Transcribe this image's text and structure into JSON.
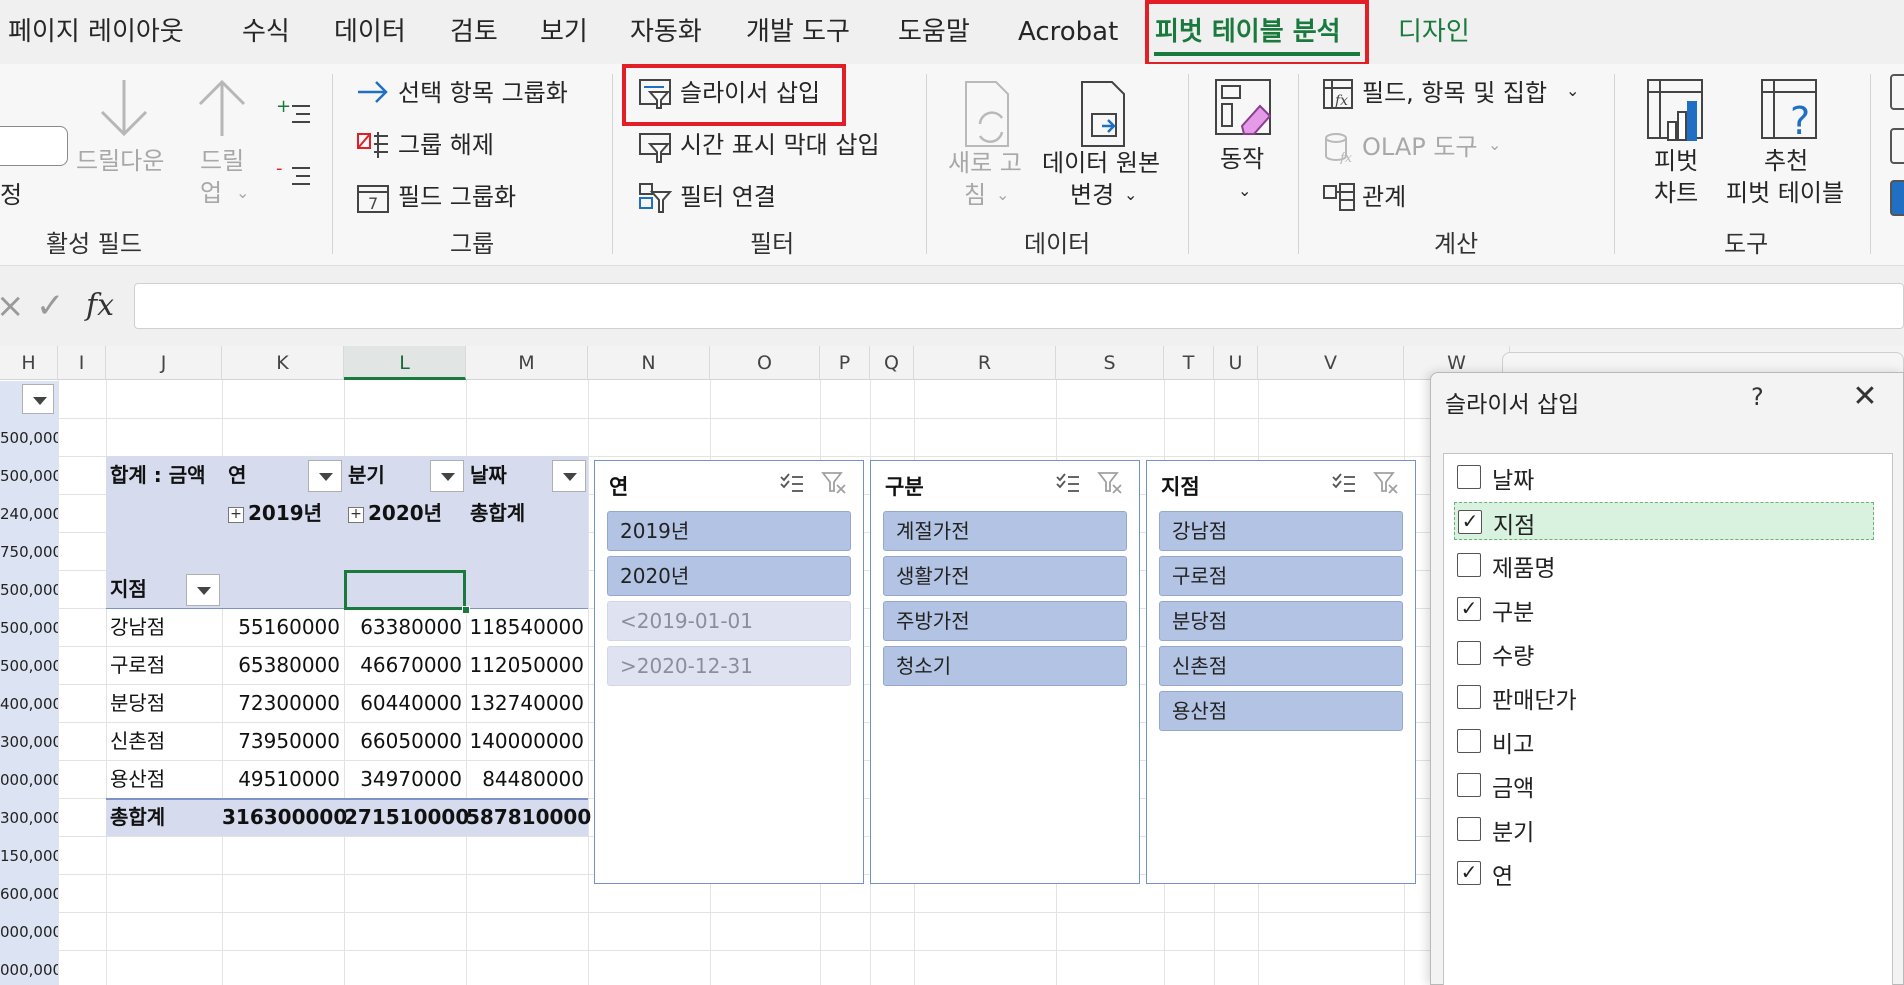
{
  "menu": {
    "tabs": [
      {
        "label": "페이지 레이아웃"
      },
      {
        "label": "수식"
      },
      {
        "label": "데이터"
      },
      {
        "label": "검토"
      },
      {
        "label": "보기"
      },
      {
        "label": "자동화"
      },
      {
        "label": "개발 도구"
      },
      {
        "label": "도움말"
      },
      {
        "label": "Acrobat"
      },
      {
        "label": "피벗 테이블 분석"
      },
      {
        "label": "디자인"
      }
    ],
    "active_tab": "피벗 테이블 분석"
  },
  "ribbon": {
    "active_field": {
      "partial_label": "정",
      "drilldown": "드릴다운",
      "drillup_1": "드릴",
      "drillup_2": "업",
      "group_label": "활성 필드"
    },
    "group": {
      "group_selection": "선택 항목 그룹화",
      "ungroup": "그룹 해제",
      "group_field": "필드 그룹화",
      "group_label": "그룹"
    },
    "filter": {
      "insert_slicer": "슬라이서 삽입",
      "insert_timeline": "시간 표시 막대 삽입",
      "filter_connections": "필터 연결",
      "group_label": "필터"
    },
    "data": {
      "refresh_1": "새로 고",
      "refresh_2": "침",
      "change_source_1": "데이터 원본",
      "change_source_2": "변경",
      "group_label": "데이터"
    },
    "actions": {
      "label": "동작"
    },
    "calculations": {
      "fields_items_sets": "필드, 항목 및 집합",
      "olap_tools": "OLAP 도구",
      "relationships": "관계",
      "group_label": "계산"
    },
    "tools": {
      "pivot_chart_1": "피벗",
      "pivot_chart_2": "차트",
      "recommended_1": "추천",
      "recommended_2": "피벗 테이블",
      "group_label": "도구"
    }
  },
  "formula_bar": {
    "cancel": "×",
    "enter": "✓",
    "fx": "fx",
    "value": ""
  },
  "sheet": {
    "columns": [
      "H",
      "I",
      "J",
      "K",
      "L",
      "M",
      "N",
      "O",
      "P",
      "Q",
      "R",
      "S",
      "T",
      "U",
      "V",
      "W"
    ],
    "selected_column": "L",
    "column_h_values": [
      "",
      "500,000",
      "500,000",
      "240,000",
      "750,000",
      "500,000",
      "500,000",
      "500,000",
      "400,000",
      "300,000",
      "000,000",
      "300,000",
      "150,000",
      "600,000",
      "000,000",
      "000,000"
    ],
    "pivot": {
      "value_label": "합계 : 금액",
      "col_field_1": "연",
      "col_field_2": "분기",
      "col_field_3": "날짜",
      "col_2019": "2019년",
      "col_2020": "2020년",
      "col_total": "총합계",
      "row_field": "지점",
      "rows": [
        {
          "name": "강남점",
          "v2019": "55160000",
          "v2020": "63380000",
          "total": "118540000"
        },
        {
          "name": "구로점",
          "v2019": "65380000",
          "v2020": "46670000",
          "total": "112050000"
        },
        {
          "name": "분당점",
          "v2019": "72300000",
          "v2020": "60440000",
          "total": "132740000"
        },
        {
          "name": "신촌점",
          "v2019": "73950000",
          "v2020": "66050000",
          "total": "140000000"
        },
        {
          "name": "용산점",
          "v2019": "49510000",
          "v2020": "34970000",
          "total": "84480000"
        }
      ],
      "grand_total": {
        "name": "총합계",
        "v2019": "316300000",
        "v2020": "271510000",
        "total": "587810000"
      }
    },
    "slicers": [
      {
        "title": "연",
        "items": [
          {
            "label": "2019년",
            "has_data": true
          },
          {
            "label": "2020년",
            "has_data": true
          },
          {
            "label": "<2019-01-01",
            "has_data": false
          },
          {
            "label": ">2020-12-31",
            "has_data": false
          }
        ]
      },
      {
        "title": "구분",
        "items": [
          {
            "label": "계절가전",
            "has_data": true
          },
          {
            "label": "생활가전",
            "has_data": true
          },
          {
            "label": "주방가전",
            "has_data": true
          },
          {
            "label": "청소기",
            "has_data": true
          }
        ]
      },
      {
        "title": "지점",
        "items": [
          {
            "label": "강남점",
            "has_data": true
          },
          {
            "label": "구로점",
            "has_data": true
          },
          {
            "label": "분당점",
            "has_data": true
          },
          {
            "label": "신촌점",
            "has_data": true
          },
          {
            "label": "용산점",
            "has_data": true
          }
        ]
      }
    ]
  },
  "dialog": {
    "title": "슬라이서 삽입",
    "help": "?",
    "close": "✕",
    "fields": [
      {
        "label": "날짜",
        "checked": false
      },
      {
        "label": "지점",
        "checked": true
      },
      {
        "label": "제품명",
        "checked": false
      },
      {
        "label": "구분",
        "checked": true
      },
      {
        "label": "수량",
        "checked": false
      },
      {
        "label": "판매단가",
        "checked": false
      },
      {
        "label": "비고",
        "checked": false
      },
      {
        "label": "금액",
        "checked": false
      },
      {
        "label": "분기",
        "checked": false
      },
      {
        "label": "연",
        "checked": true
      }
    ],
    "focused_field": "지점"
  },
  "colors": {
    "accent_green": "#1a7a3d",
    "highlight_red": "#e21f26",
    "slicer_item": "#b3c3e3",
    "pivot_header": "#d6dcee"
  }
}
